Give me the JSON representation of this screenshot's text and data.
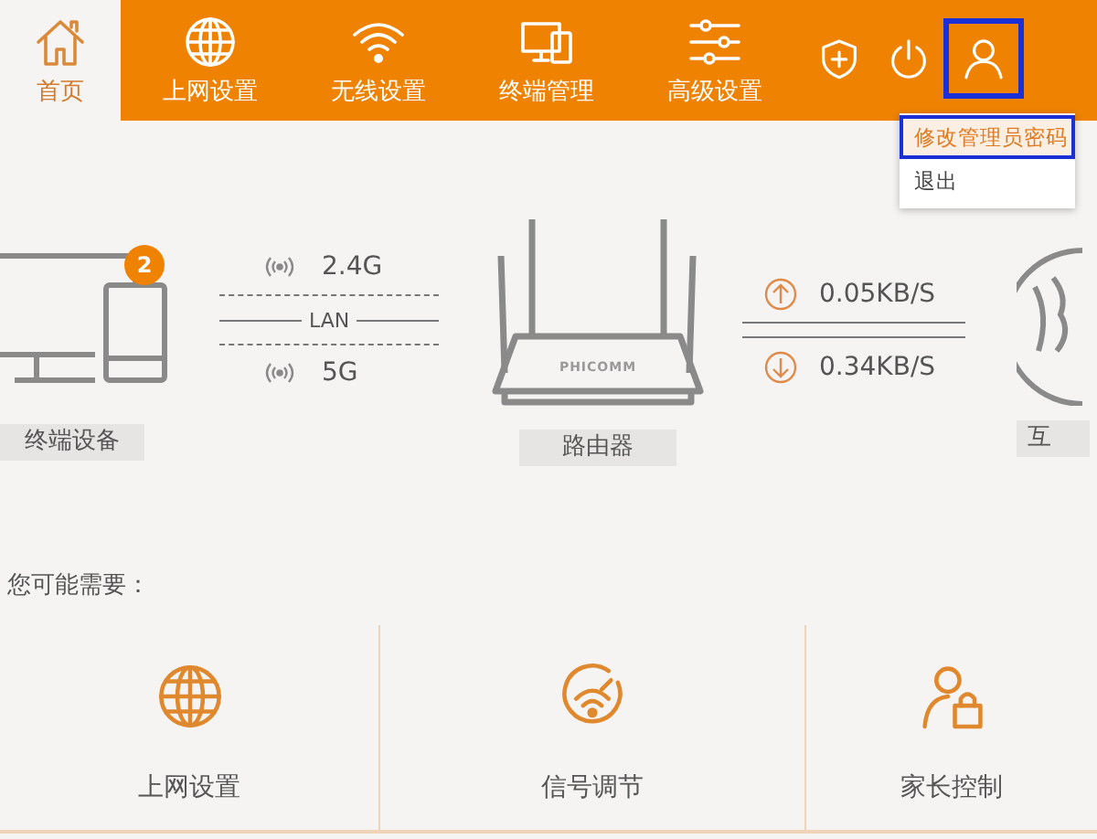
{
  "nav": {
    "items": [
      {
        "label": "首页",
        "kind": "home",
        "selected": true
      },
      {
        "label": "上网设置",
        "kind": "globe",
        "selected": false
      },
      {
        "label": "无线设置",
        "kind": "wifi",
        "selected": false
      },
      {
        "label": "终端管理",
        "kind": "devices",
        "selected": false
      },
      {
        "label": "高级设置",
        "kind": "sliders",
        "selected": false
      }
    ]
  },
  "toolbar_icons": [
    {
      "kind": "shield",
      "highlighted": false
    },
    {
      "kind": "power",
      "highlighted": false
    },
    {
      "kind": "user",
      "highlighted": true
    }
  ],
  "user_menu": {
    "items": [
      {
        "label": "修改管理员密码",
        "selected": true,
        "highlighted": true
      },
      {
        "label": "退出",
        "selected": false,
        "highlighted": false
      }
    ]
  },
  "status": {
    "devices": {
      "label": "终端设备",
      "count": "2"
    },
    "wifi": [
      {
        "band": "2.4G"
      },
      {
        "band": "5G"
      }
    ],
    "lan_label": "LAN",
    "router": {
      "brand": "PHICOMM",
      "label": "路由器"
    },
    "speeds": [
      {
        "kind": "up",
        "value": "0.05KB/S"
      },
      {
        "kind": "down",
        "value": "0.34KB/S"
      }
    ],
    "internet": {
      "label": "互"
    }
  },
  "suggestions": {
    "title": "您可能需要：",
    "items": [
      {
        "kind": "globe",
        "label": "上网设置"
      },
      {
        "kind": "signal",
        "label": "信号调节"
      },
      {
        "kind": "user-lock",
        "label": "家长控制"
      }
    ]
  }
}
